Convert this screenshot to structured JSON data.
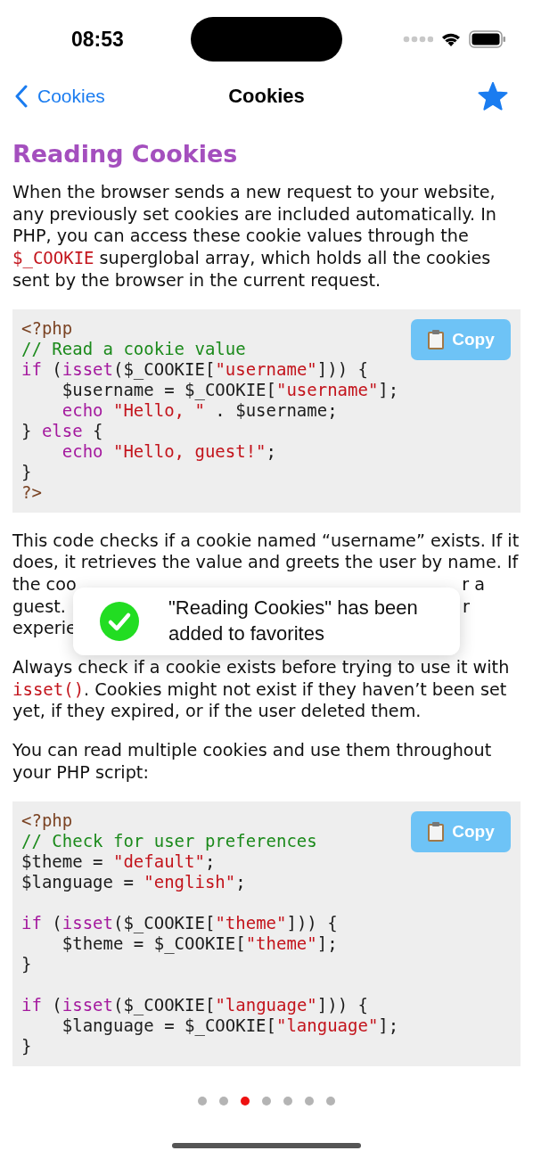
{
  "status_bar": {
    "time": "08:53"
  },
  "nav": {
    "back_label": "Cookies",
    "title": "Cookies",
    "favorite": true
  },
  "heading": "Reading Cookies",
  "content": [
    {
      "kind": "paragraph",
      "segments": [
        {
          "kind": "text",
          "text": "When the browser sends a new request to your website, any previously set cookies are included automatically. In PHP, you can access these cookie values through the "
        },
        {
          "kind": "code",
          "text": "$_COOKIE"
        },
        {
          "kind": "text",
          "text": " superglobal array, which holds all the cookies sent by the browser in the current request."
        }
      ]
    },
    {
      "kind": "code",
      "copy_label": "Copy",
      "lines": [
        {
          "tokens": [
            {
              "kind": "tag",
              "t": "<?php"
            }
          ]
        },
        {
          "tokens": [
            {
              "kind": "comment",
              "t": "// Read a cookie value"
            }
          ]
        },
        {
          "tokens": [
            {
              "kind": "kw",
              "t": "if"
            },
            {
              "kind": "plain",
              "t": " ("
            },
            {
              "kind": "kw",
              "t": "isset"
            },
            {
              "kind": "plain",
              "t": "($_COOKIE["
            },
            {
              "kind": "str",
              "t": "\"username\""
            },
            {
              "kind": "plain",
              "t": "])) {"
            }
          ]
        },
        {
          "indented": true,
          "tokens": [
            {
              "kind": "plain",
              "t": "$username = $_COOKIE["
            },
            {
              "kind": "str",
              "t": "\"username\""
            },
            {
              "kind": "plain",
              "t": "];"
            }
          ]
        },
        {
          "indented": true,
          "tokens": [
            {
              "kind": "kw",
              "t": "echo"
            },
            {
              "kind": "str",
              "t": " \"Hello, \""
            },
            {
              "kind": "plain",
              "t": " . $username;"
            }
          ]
        },
        {
          "tokens": [
            {
              "kind": "plain",
              "t": "} "
            },
            {
              "kind": "kw",
              "t": "else"
            },
            {
              "kind": "plain",
              "t": " {"
            }
          ]
        },
        {
          "indented": true,
          "tokens": [
            {
              "kind": "kw",
              "t": "echo"
            },
            {
              "kind": "str",
              "t": " \"Hello, guest!\""
            },
            {
              "kind": "plain",
              "t": ";"
            }
          ]
        },
        {
          "tokens": [
            {
              "kind": "plain",
              "t": "}"
            }
          ]
        },
        {
          "tokens": [
            {
              "kind": "tag",
              "t": "?>"
            }
          ]
        }
      ]
    },
    {
      "kind": "covered_paragraph",
      "lines": [
        {
          "left": "This code checks if a cookie named “username” exists. If it"
        },
        {
          "left": "does, it retrieves the value and greets the user by name. If"
        },
        {
          "left": "the coo",
          "right": "r a"
        },
        {
          "left": "guest.",
          "right": "r"
        },
        {
          "left": "experie"
        }
      ]
    },
    {
      "kind": "paragraph",
      "segments": [
        {
          "kind": "text",
          "text": "Always check if a cookie exists before trying to use it with "
        },
        {
          "kind": "code",
          "text": "isset()"
        },
        {
          "kind": "text",
          "text": ". Cookies might not exist if they haven’t been set yet, if they expired, or if the user deleted them."
        }
      ]
    },
    {
      "kind": "paragraph",
      "segments": [
        {
          "kind": "text",
          "text": "You can read multiple cookies and use them throughout your PHP script:"
        }
      ]
    },
    {
      "kind": "code",
      "copy_label": "Copy",
      "lines": [
        {
          "tokens": [
            {
              "kind": "tag",
              "t": "<?php"
            }
          ]
        },
        {
          "tokens": [
            {
              "kind": "comment",
              "t": "// Check for user preferences"
            }
          ]
        },
        {
          "tokens": [
            {
              "kind": "plain",
              "t": "$theme = "
            },
            {
              "kind": "str",
              "t": "\"default\""
            },
            {
              "kind": "plain",
              "t": ";"
            }
          ]
        },
        {
          "tokens": [
            {
              "kind": "plain",
              "t": "$language = "
            },
            {
              "kind": "str",
              "t": "\"english\""
            },
            {
              "kind": "plain",
              "t": ";"
            }
          ]
        },
        {
          "space_before": true,
          "tokens": [
            {
              "kind": "kw",
              "t": "if"
            },
            {
              "kind": "plain",
              "t": " ("
            },
            {
              "kind": "kw",
              "t": "isset"
            },
            {
              "kind": "plain",
              "t": "($_COOKIE["
            },
            {
              "kind": "str",
              "t": "\"theme\""
            },
            {
              "kind": "plain",
              "t": "])) {"
            }
          ]
        },
        {
          "indented": true,
          "tokens": [
            {
              "kind": "plain",
              "t": "$theme = $_COOKIE["
            },
            {
              "kind": "str",
              "t": "\"theme\""
            },
            {
              "kind": "plain",
              "t": "];"
            }
          ]
        },
        {
          "tokens": [
            {
              "kind": "plain",
              "t": "}"
            }
          ]
        },
        {
          "space_before": true,
          "tokens": [
            {
              "kind": "kw",
              "t": "if"
            },
            {
              "kind": "plain",
              "t": " ("
            },
            {
              "kind": "kw",
              "t": "isset"
            },
            {
              "kind": "plain",
              "t": "($_COOKIE["
            },
            {
              "kind": "str",
              "t": "\"language\""
            },
            {
              "kind": "plain",
              "t": "])) {"
            }
          ]
        },
        {
          "indented": true,
          "tokens": [
            {
              "kind": "plain",
              "t": "$language = $_COOKIE["
            },
            {
              "kind": "str",
              "t": "\"language\""
            },
            {
              "kind": "plain",
              "t": "];"
            }
          ]
        },
        {
          "tokens": [
            {
              "kind": "plain",
              "t": "}"
            }
          ]
        }
      ]
    }
  ],
  "toast": {
    "message": "\"Reading Cookies\" has been added to favorites"
  },
  "page_dots": [
    {
      "selected": false
    },
    {
      "selected": false
    },
    {
      "selected": true
    },
    {
      "selected": false
    },
    {
      "selected": false
    },
    {
      "selected": false
    },
    {
      "selected": false
    }
  ]
}
